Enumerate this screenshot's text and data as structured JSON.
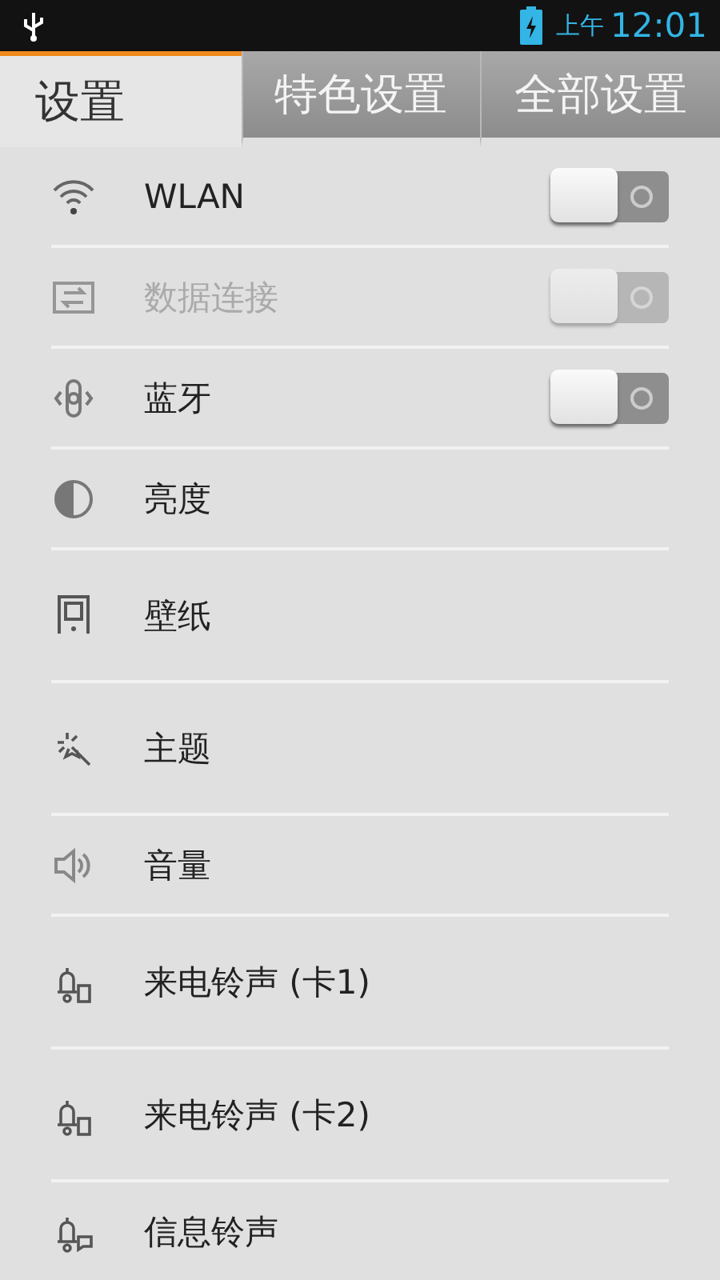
{
  "status_bar": {
    "period": "上午",
    "time": "12:01"
  },
  "tabs": [
    {
      "label": "设置",
      "selected": true
    },
    {
      "label": "特色设置",
      "selected": false
    },
    {
      "label": "全部设置",
      "selected": false
    }
  ],
  "settings": [
    {
      "kind": "switch",
      "label": "WLAN",
      "on": false,
      "disabled": false
    },
    {
      "kind": "switch",
      "label": "数据连接",
      "on": false,
      "disabled": true
    },
    {
      "kind": "switch",
      "label": "蓝牙",
      "on": false,
      "disabled": false
    },
    {
      "kind": "item",
      "label": "亮度"
    },
    {
      "kind": "picker",
      "label": "壁纸"
    },
    {
      "kind": "picker",
      "label": "主题"
    },
    {
      "kind": "item",
      "label": "音量"
    },
    {
      "kind": "picker",
      "label": "来电铃声 (卡1)"
    },
    {
      "kind": "picker",
      "label": "来电铃声 (卡2)"
    },
    {
      "kind": "item",
      "label": "信息铃声"
    }
  ]
}
